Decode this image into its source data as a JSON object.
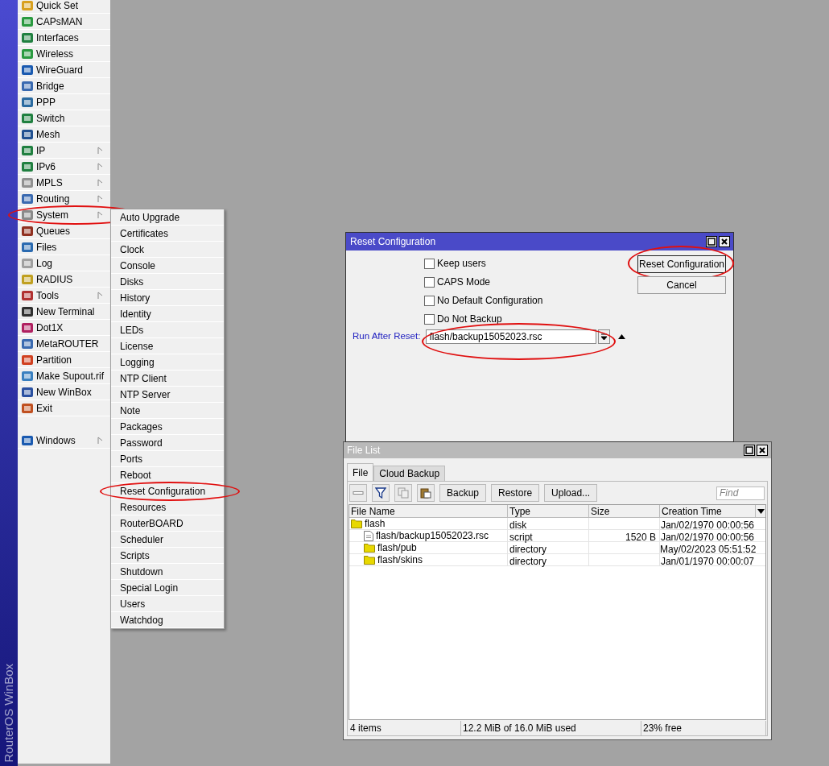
{
  "sidebar": {
    "brand": "RouterOS WinBox",
    "items": [
      {
        "label": "Quick Set",
        "has_submenu": false,
        "circled": false
      },
      {
        "label": "CAPsMAN",
        "has_submenu": false,
        "circled": false
      },
      {
        "label": "Interfaces",
        "has_submenu": false,
        "circled": false
      },
      {
        "label": "Wireless",
        "has_submenu": false,
        "circled": false
      },
      {
        "label": "WireGuard",
        "has_submenu": false,
        "circled": false
      },
      {
        "label": "Bridge",
        "has_submenu": false,
        "circled": false
      },
      {
        "label": "PPP",
        "has_submenu": false,
        "circled": false
      },
      {
        "label": "Switch",
        "has_submenu": false,
        "circled": false
      },
      {
        "label": "Mesh",
        "has_submenu": false,
        "circled": false
      },
      {
        "label": "IP",
        "has_submenu": true,
        "circled": false
      },
      {
        "label": "IPv6",
        "has_submenu": true,
        "circled": false
      },
      {
        "label": "MPLS",
        "has_submenu": true,
        "circled": false
      },
      {
        "label": "Routing",
        "has_submenu": true,
        "circled": false
      },
      {
        "label": "System",
        "has_submenu": true,
        "circled": true
      },
      {
        "label": "Queues",
        "has_submenu": false,
        "circled": false
      },
      {
        "label": "Files",
        "has_submenu": false,
        "circled": false
      },
      {
        "label": "Log",
        "has_submenu": false,
        "circled": false
      },
      {
        "label": "RADIUS",
        "has_submenu": false,
        "circled": false
      },
      {
        "label": "Tools",
        "has_submenu": true,
        "circled": false
      },
      {
        "label": "New Terminal",
        "has_submenu": false,
        "circled": false
      },
      {
        "label": "Dot1X",
        "has_submenu": false,
        "circled": false
      },
      {
        "label": "MetaROUTER",
        "has_submenu": false,
        "circled": false
      },
      {
        "label": "Partition",
        "has_submenu": false,
        "circled": false
      },
      {
        "label": "Make Supout.rif",
        "has_submenu": false,
        "circled": false
      },
      {
        "label": "New WinBox",
        "has_submenu": false,
        "circled": false
      },
      {
        "label": "Exit",
        "has_submenu": false,
        "circled": false
      }
    ],
    "bottom_items": [
      {
        "label": "Windows",
        "has_submenu": true,
        "circled": false
      }
    ]
  },
  "submenu": {
    "items": [
      {
        "label": "Auto Upgrade",
        "circled": false
      },
      {
        "label": "Certificates",
        "circled": false
      },
      {
        "label": "Clock",
        "circled": false
      },
      {
        "label": "Console",
        "circled": false
      },
      {
        "label": "Disks",
        "circled": false
      },
      {
        "label": "History",
        "circled": false
      },
      {
        "label": "Identity",
        "circled": false
      },
      {
        "label": "LEDs",
        "circled": false
      },
      {
        "label": "License",
        "circled": false
      },
      {
        "label": "Logging",
        "circled": false
      },
      {
        "label": "NTP Client",
        "circled": false
      },
      {
        "label": "NTP Server",
        "circled": false
      },
      {
        "label": "Note",
        "circled": false
      },
      {
        "label": "Packages",
        "circled": false
      },
      {
        "label": "Password",
        "circled": false
      },
      {
        "label": "Ports",
        "circled": false
      },
      {
        "label": "Reboot",
        "circled": false
      },
      {
        "label": "Reset Configuration",
        "circled": true
      },
      {
        "label": "Resources",
        "circled": false
      },
      {
        "label": "RouterBOARD",
        "circled": false
      },
      {
        "label": "Scheduler",
        "circled": false
      },
      {
        "label": "Scripts",
        "circled": false
      },
      {
        "label": "Shutdown",
        "circled": false
      },
      {
        "label": "Special Login",
        "circled": false
      },
      {
        "label": "Users",
        "circled": false
      },
      {
        "label": "Watchdog",
        "circled": false
      }
    ]
  },
  "reset_dialog": {
    "title": "Reset Configuration",
    "active": true,
    "options": [
      {
        "label": "Keep users",
        "checked": false
      },
      {
        "label": "CAPS Mode",
        "checked": false
      },
      {
        "label": "No Default Configuration",
        "checked": false
      },
      {
        "label": "Do Not Backup",
        "checked": false
      }
    ],
    "run_after_reset": {
      "label": "Run After Reset:",
      "value": "flash/backup15052023.rsc",
      "circled": true
    },
    "buttons": [
      {
        "label": "Reset Configuration",
        "circled": true
      },
      {
        "label": "Cancel",
        "circled": false
      }
    ]
  },
  "file_list": {
    "title": "File List",
    "active": false,
    "tabs": [
      {
        "label": "File",
        "selected": true
      },
      {
        "label": "Cloud Backup",
        "selected": false
      }
    ],
    "toolbar": {
      "buttons": [
        "Backup",
        "Restore",
        "Upload..."
      ],
      "search": {
        "placeholder": "Find"
      }
    },
    "table": {
      "columns": [
        "File Name",
        "Type",
        "Size",
        "Creation Time"
      ],
      "rows": [
        {
          "name": "flash",
          "kind": "folder",
          "type": "disk",
          "created": "Jan/02/1970 00:00:56",
          "children": [
            {
              "name": "flash/backup15052023.rsc",
              "kind": "file",
              "type": "script",
              "size": "1520 B",
              "created": "Jan/02/1970 00:00:56"
            },
            {
              "name": "flash/pub",
              "kind": "folder",
              "type": "directory",
              "created": "May/02/2023 05:51:52"
            },
            {
              "name": "flash/skins",
              "kind": "folder",
              "type": "directory",
              "created": "Jan/01/1970 00:00:07"
            }
          ]
        }
      ]
    },
    "status_bar": [
      "4 items",
      "12.2 MiB of 16.0 MiB used",
      "23% free"
    ]
  }
}
